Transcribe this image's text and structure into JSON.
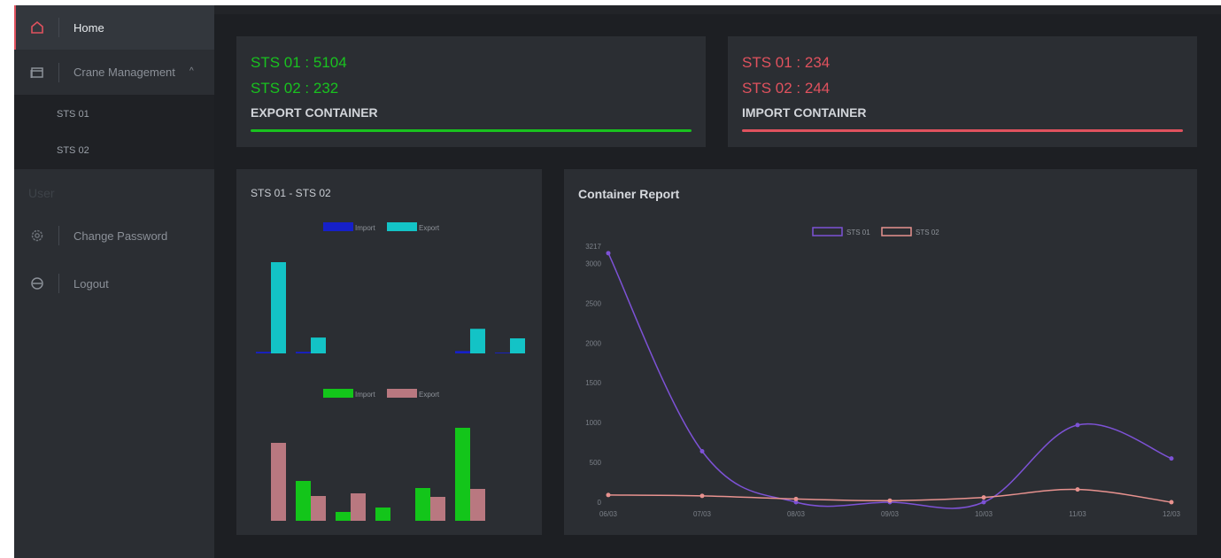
{
  "sidebar": {
    "items": [
      {
        "label": "Home",
        "icon": "home-icon"
      },
      {
        "label": "Crane Management",
        "icon": "window-icon"
      }
    ],
    "crane_sub": [
      "STS 01",
      "STS 02"
    ],
    "user_section": "User",
    "user_items": [
      {
        "label": "Change Password",
        "icon": "settings-icon"
      },
      {
        "label": "Logout",
        "icon": "logout-icon"
      }
    ]
  },
  "export_card": {
    "line1": "STS 01 : 5104",
    "line2": "STS 02 : 232",
    "title": "EXPORT CONTAINER",
    "color": "#19c21f"
  },
  "import_card": {
    "line1": "STS 01 : 234",
    "line2": "STS 02 : 244",
    "title": "IMPORT CONTAINER",
    "color": "#e0525e"
  },
  "bar_panel": {
    "title": "STS 01 - STS 02"
  },
  "line_panel": {
    "title": "Container Report"
  },
  "chart_data": [
    {
      "type": "bar",
      "series": [
        {
          "name": "Import",
          "color": "#1620c9",
          "values": [
            2,
            2,
            0,
            0,
            0,
            3,
            1
          ]
        },
        {
          "name": "Export",
          "color": "#13c3c6",
          "values": [
            115,
            20,
            0,
            0,
            0,
            31,
            19
          ]
        }
      ]
    },
    {
      "type": "bar",
      "series": [
        {
          "name": "Import",
          "color": "#13c51a",
          "values": [
            0,
            45,
            10,
            15,
            37,
            105,
            0
          ]
        },
        {
          "name": "Export",
          "color": "#b97880",
          "values": [
            88,
            28,
            31,
            0,
            27,
            36,
            0
          ]
        }
      ]
    },
    {
      "type": "line",
      "x": [
        "06/03",
        "07/03",
        "08/03",
        "09/03",
        "10/03",
        "11/03",
        "12/03"
      ],
      "ylim": [
        0,
        3217
      ],
      "yticks": [
        0,
        500,
        1000,
        1500,
        2000,
        2500,
        3000,
        3217
      ],
      "series": [
        {
          "name": "STS 01",
          "color": "#7d52d6",
          "values": [
            3130,
            640,
            0,
            0,
            0,
            970,
            550
          ]
        },
        {
          "name": "STS 02",
          "color": "#e8928f",
          "values": [
            90,
            80,
            40,
            20,
            60,
            160,
            0
          ]
        }
      ]
    }
  ]
}
